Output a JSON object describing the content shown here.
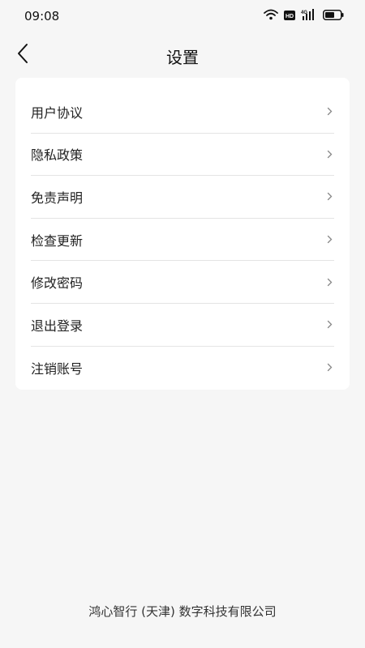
{
  "status_bar": {
    "time": "09:08",
    "icons": [
      "wifi-icon",
      "hd-icon",
      "4g-signal-icon",
      "battery-icon"
    ]
  },
  "nav": {
    "back_icon": "chevron-left-icon",
    "title": "设置"
  },
  "settings": {
    "items": [
      {
        "label": "用户协议"
      },
      {
        "label": "隐私政策"
      },
      {
        "label": "免责声明"
      },
      {
        "label": "检查更新"
      },
      {
        "label": "修改密码"
      },
      {
        "label": "退出登录"
      },
      {
        "label": "注销账号"
      }
    ]
  },
  "footer": {
    "company": "鸿心智行 (天津) 数字科技有限公司"
  },
  "colors": {
    "background": "#f6f6f6",
    "card": "#ffffff",
    "divider": "#e4e4e4",
    "chevron": "#888888"
  }
}
